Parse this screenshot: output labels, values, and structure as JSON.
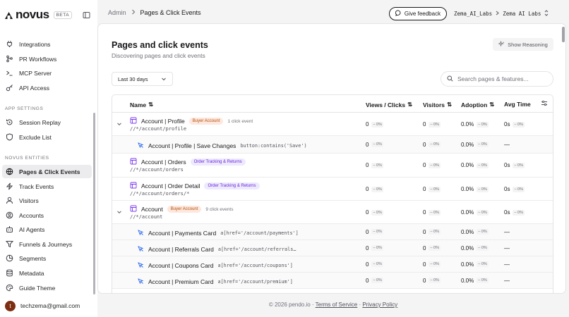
{
  "brand": {
    "name": "novus",
    "badge": "BETA"
  },
  "sidebar": {
    "items_top": [
      {
        "label": "Integrations",
        "icon": "plug-icon"
      },
      {
        "label": "PR Workflows",
        "icon": "git-branch-icon"
      },
      {
        "label": "MCP Server",
        "icon": "terminal-icon"
      },
      {
        "label": "API Access",
        "icon": "key-icon"
      }
    ],
    "section_settings": "APP SETTINGS",
    "items_settings": [
      {
        "label": "Session Replay",
        "icon": "replay-icon"
      },
      {
        "label": "Exclude List",
        "icon": "shield-icon"
      }
    ],
    "section_entities": "NOVUS ENTITIES",
    "items_entities": [
      {
        "label": "Pages & Click Events",
        "icon": "globe-icon",
        "active": true
      },
      {
        "label": "Track Events",
        "icon": "lightning-icon"
      },
      {
        "label": "Visitors",
        "icon": "user-icon"
      },
      {
        "label": "Accounts",
        "icon": "accounts-icon"
      },
      {
        "label": "AI Agents",
        "icon": "bot-icon"
      },
      {
        "label": "Funnels & Journeys",
        "icon": "funnel-icon"
      },
      {
        "label": "Segments",
        "icon": "segments-icon"
      },
      {
        "label": "Metadata",
        "icon": "database-icon"
      },
      {
        "label": "Guide Theme",
        "icon": "palette-icon"
      }
    ],
    "user": {
      "initial": "t",
      "email": "techzema@gmail.com"
    }
  },
  "topbar": {
    "breadcrumb": [
      "Admin",
      "Pages & Click Events"
    ],
    "feedback_label": "Give feedback",
    "org": "Zema_AI_Labs",
    "workspace": "Zema AI Labs"
  },
  "main": {
    "title": "Pages and click events",
    "subtitle": "Discovering pages and click events",
    "reasoning_label": "Show Reasoning",
    "date_range": "Last 30 days",
    "search_placeholder": "Search pages & features..."
  },
  "table": {
    "columns": [
      "Name",
      "Views / Clicks",
      "Visitors",
      "Adoption",
      "Avg Time"
    ],
    "rows": [
      {
        "type": "page",
        "expandable": true,
        "name": "Account | Profile",
        "tag": "Buyer Account",
        "tag_style": "buyer",
        "events": "1 click event",
        "url": "//*/account/profile",
        "views": "0",
        "views_delta": "– 0%",
        "visitors": "0",
        "visitors_delta": "– 0%",
        "adoption": "0.0%",
        "adoption_delta": "– 0%",
        "time": "0s",
        "time_delta": "– 0%"
      },
      {
        "type": "click",
        "name": "Account | Profile | Save Changes",
        "selector": "button:contains('Save')",
        "views": "0",
        "views_delta": "– 0%",
        "visitors": "0",
        "visitors_delta": "– 0%",
        "adoption": "0.0%",
        "adoption_delta": "– 0%",
        "time": "—"
      },
      {
        "type": "page",
        "expandable": false,
        "name": "Account | Orders",
        "tag": "Order Tracking & Returns",
        "tag_style": "order",
        "url": "//*/account/orders",
        "views": "0",
        "views_delta": "– 0%",
        "visitors": "0",
        "visitors_delta": "– 0%",
        "adoption": "0.0%",
        "adoption_delta": "– 0%",
        "time": "0s",
        "time_delta": "– 0%"
      },
      {
        "type": "page",
        "expandable": false,
        "name": "Account | Order Detail",
        "tag": "Order Tracking & Returns",
        "tag_style": "order",
        "url": "//*/account/orders/*",
        "views": "0",
        "views_delta": "– 0%",
        "visitors": "0",
        "visitors_delta": "– 0%",
        "adoption": "0.0%",
        "adoption_delta": "– 0%",
        "time": "0s",
        "time_delta": "– 0%"
      },
      {
        "type": "page",
        "expandable": true,
        "name": "Account",
        "tag": "Buyer Account",
        "tag_style": "buyer",
        "events": "9 click events",
        "url": "//*/account",
        "views": "0",
        "views_delta": "– 0%",
        "visitors": "0",
        "visitors_delta": "– 0%",
        "adoption": "0.0%",
        "adoption_delta": "– 0%",
        "time": "0s",
        "time_delta": "– 0%"
      },
      {
        "type": "click",
        "name": "Account | Payments Card",
        "selector": "a[href='/account/payments']",
        "views": "0",
        "views_delta": "– 0%",
        "visitors": "0",
        "visitors_delta": "– 0%",
        "adoption": "0.0%",
        "adoption_delta": "– 0%",
        "time": "—"
      },
      {
        "type": "click",
        "name": "Account | Referrals Card",
        "selector": "a[href='/account/referrals…",
        "views": "0",
        "views_delta": "– 0%",
        "visitors": "0",
        "visitors_delta": "– 0%",
        "adoption": "0.0%",
        "adoption_delta": "– 0%",
        "time": "—"
      },
      {
        "type": "click",
        "name": "Account | Coupons Card",
        "selector": "a[href='/account/coupons']",
        "views": "0",
        "views_delta": "– 0%",
        "visitors": "0",
        "visitors_delta": "– 0%",
        "adoption": "0.0%",
        "adoption_delta": "– 0%",
        "time": "—"
      },
      {
        "type": "click",
        "name": "Account | Premium Card",
        "selector": "a[href='/account/premium']",
        "views": "0",
        "views_delta": "– 0%",
        "visitors": "0",
        "visitors_delta": "– 0%",
        "adoption": "0.0%",
        "adoption_delta": "– 0%",
        "time": "—"
      }
    ]
  },
  "footer": {
    "copyright": "© 2026 pendo.io · ",
    "terms": "Terms of Service",
    "sep": " · ",
    "privacy": "Privacy Policy"
  }
}
